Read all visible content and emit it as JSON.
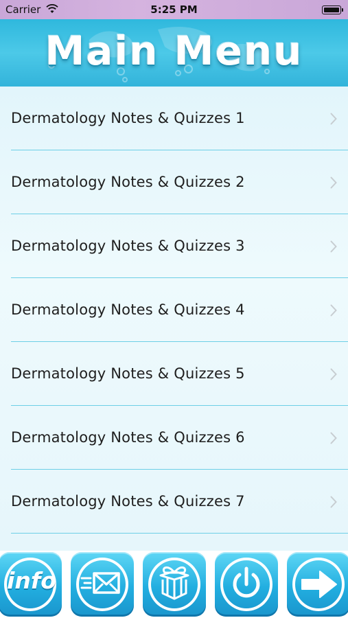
{
  "status_bar": {
    "carrier": "Carrier",
    "time": "5:25 PM"
  },
  "header": {
    "title": "Main Menu"
  },
  "menu": {
    "items": [
      {
        "label": "Dermatology Notes & Quizzes 1"
      },
      {
        "label": "Dermatology Notes & Quizzes 2"
      },
      {
        "label": "Dermatology Notes & Quizzes 3"
      },
      {
        "label": "Dermatology Notes & Quizzes 4"
      },
      {
        "label": "Dermatology Notes & Quizzes 5"
      },
      {
        "label": "Dermatology Notes & Quizzes 6"
      },
      {
        "label": "Dermatology Notes & Quizzes 7"
      }
    ]
  },
  "toolbar": {
    "info_label": "info",
    "buttons": [
      {
        "icon": "info-icon"
      },
      {
        "icon": "mail-icon"
      },
      {
        "icon": "gift-icon"
      },
      {
        "icon": "power-icon"
      },
      {
        "icon": "arrow-right-icon"
      }
    ]
  },
  "colors": {
    "status_bar": "#d5b3df",
    "header": "#4cc9e8",
    "separator": "#6ccfe6",
    "list_background": "#e9f8fc",
    "button": "#22aee0"
  }
}
